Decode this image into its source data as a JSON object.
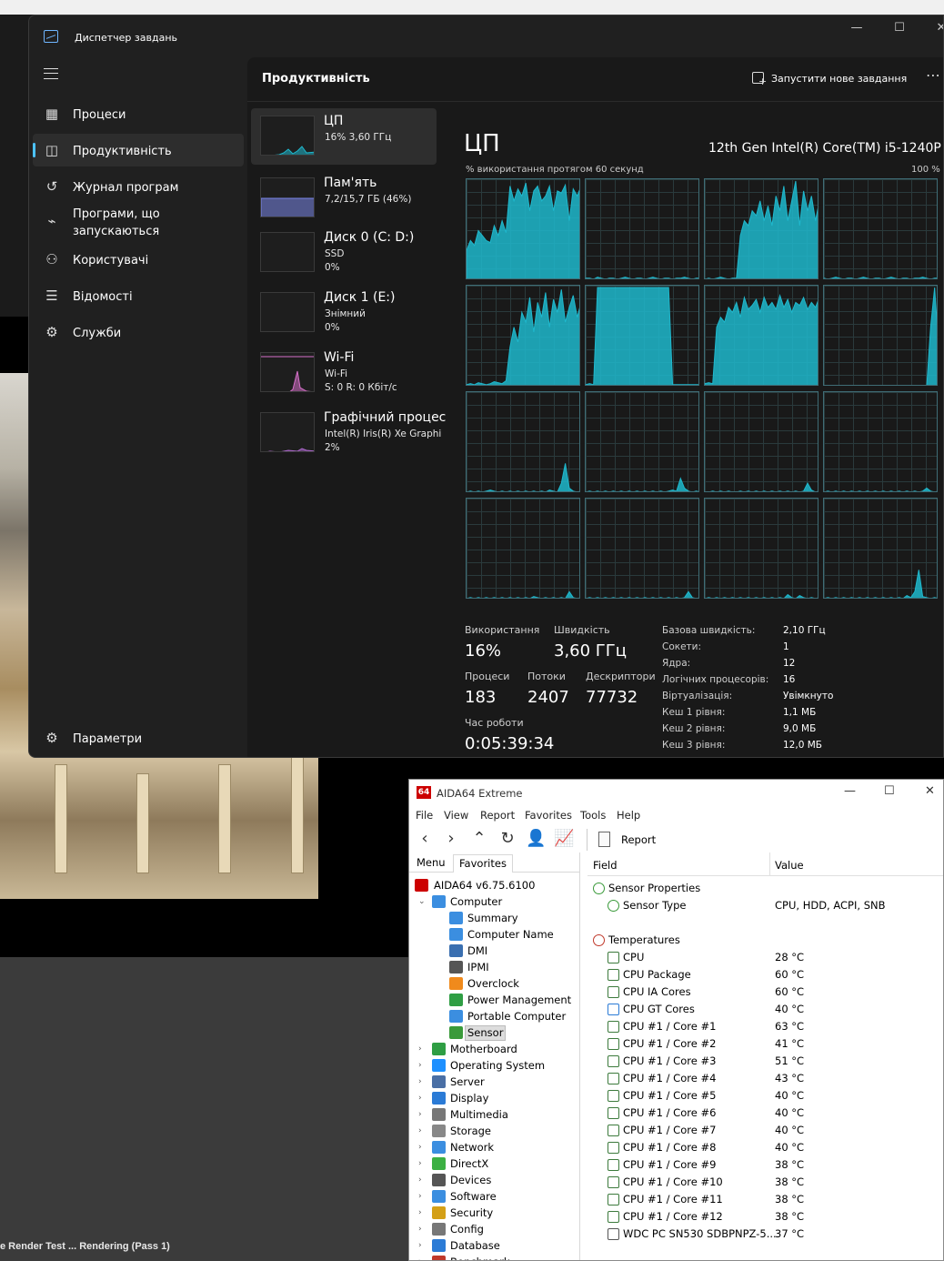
{
  "background": {
    "status_text": "e Render Test ... Rendering (Pass 1)"
  },
  "task_manager": {
    "title": "Диспетчер завдань",
    "nav": [
      {
        "label": "Процеси",
        "icon": "processes-icon",
        "glyph": "▦",
        "active": false
      },
      {
        "label": "Продуктивність",
        "icon": "performance-icon",
        "glyph": "◫",
        "active": true
      },
      {
        "label": "Журнал програм",
        "icon": "history-icon",
        "glyph": "↺",
        "active": false
      },
      {
        "label": "Програми, що\nзапускаються",
        "icon": "startup-icon",
        "glyph": "⌁",
        "active": false
      },
      {
        "label": "Користувачі",
        "icon": "users-icon",
        "glyph": "⚇",
        "active": false
      },
      {
        "label": "Відомості",
        "icon": "details-icon",
        "glyph": "☰",
        "active": false
      },
      {
        "label": "Служби",
        "icon": "services-icon",
        "glyph": "⚙",
        "active": false
      }
    ],
    "settings_label": "Параметри",
    "page_title": "Продуктивність",
    "new_task_label": "Запустити нове завдання",
    "resources": [
      {
        "name": "ЦП",
        "sub1": "16% 3,60 ГГц",
        "sub2": "",
        "color": "#1fb8cd",
        "active": true
      },
      {
        "name": "Пам'ять",
        "sub1": "7,2/15,7 ГБ (46%)",
        "sub2": "",
        "color": "#7a86e8",
        "active": false
      },
      {
        "name": "Диск 0 (C: D:)",
        "sub1": "SSD",
        "sub2": "0%",
        "color": "#4caf50",
        "active": false
      },
      {
        "name": "Диск 1 (E:)",
        "sub1": "Знімний",
        "sub2": "0%",
        "color": "#4caf50",
        "active": false
      },
      {
        "name": "Wi-Fi",
        "sub1": "Wi-Fi",
        "sub2": "S: 0 R: 0 Кбіт/с",
        "color": "#d670c9",
        "active": false
      },
      {
        "name": "Графічний процес",
        "sub1": "Intel(R) Iris(R) Xe Graphi",
        "sub2": "2%",
        "color": "#b06ad1",
        "active": false
      }
    ],
    "cpu": {
      "heading": "ЦП",
      "model": "12th Gen Intel(R) Core(TM) i5-1240P",
      "axis_left": "% використання протягом 60 секунд",
      "axis_right": "100 %",
      "graph_color": "#1fb8cd",
      "stats": {
        "usage_label": "Використання",
        "usage_value": "16%",
        "speed_label": "Швидкість",
        "speed_value": "3,60 ГГц",
        "processes_label": "Процеси",
        "processes_value": "183",
        "threads_label": "Потоки",
        "threads_value": "2407",
        "handles_label": "Дескриптори",
        "handles_value": "77732",
        "uptime_label": "Час роботи",
        "uptime_value": "0:05:39:34"
      },
      "details": [
        {
          "k": "Базова швидкість:",
          "v": "2,10 ГГц"
        },
        {
          "k": "Сокети:",
          "v": "1"
        },
        {
          "k": "Ядра:",
          "v": "12"
        },
        {
          "k": "Логічних процесорів:",
          "v": "16"
        },
        {
          "k": "Віртуалізація:",
          "v": "Увімкнуто"
        },
        {
          "k": "Кеш 1 рівня:",
          "v": "1,1 МБ"
        },
        {
          "k": "Кеш 2 рівня:",
          "v": "9,0 МБ"
        },
        {
          "k": "Кеш 3 рівня:",
          "v": "12,0 МБ"
        }
      ]
    }
  },
  "aida": {
    "title": "AIDA64 Extreme",
    "logo": "64",
    "menu": [
      "File",
      "View",
      "Report",
      "Favorites",
      "Tools",
      "Help"
    ],
    "report_label": "Report",
    "tabs": [
      "Menu",
      "Favorites"
    ],
    "tree": [
      {
        "label": "AIDA64 v6.75.6100",
        "level": 0,
        "tw": "",
        "color": "#c00",
        "icon": "aida-logo-icon"
      },
      {
        "label": "Computer",
        "level": 1,
        "tw": "⌄",
        "color": "#3b8ee0",
        "icon": "computer-icon"
      },
      {
        "label": "Summary",
        "level": 2,
        "tw": "",
        "color": "#3b8ee0",
        "icon": "summary-icon"
      },
      {
        "label": "Computer Name",
        "level": 2,
        "tw": "",
        "color": "#3b8ee0",
        "icon": "computer-name-icon"
      },
      {
        "label": "DMI",
        "level": 2,
        "tw": "",
        "color": "#3a6fb0",
        "icon": "dmi-icon"
      },
      {
        "label": "IPMI",
        "level": 2,
        "tw": "",
        "color": "#555",
        "icon": "ipmi-icon"
      },
      {
        "label": "Overclock",
        "level": 2,
        "tw": "",
        "color": "#f08a1c",
        "icon": "flame-icon"
      },
      {
        "label": "Power Management",
        "level": 2,
        "tw": "",
        "color": "#2f9e44",
        "icon": "power-icon"
      },
      {
        "label": "Portable Computer",
        "level": 2,
        "tw": "",
        "color": "#3b8ee0",
        "icon": "laptop-icon"
      },
      {
        "label": "Sensor",
        "level": 2,
        "tw": "",
        "color": "#3a9a3a",
        "icon": "sensor-icon",
        "selected": true
      },
      {
        "label": "Motherboard",
        "level": 1,
        "tw": "›",
        "color": "#2f9e44",
        "icon": "motherboard-icon"
      },
      {
        "label": "Operating System",
        "level": 1,
        "tw": "›",
        "color": "#1e90ff",
        "icon": "windows-icon"
      },
      {
        "label": "Server",
        "level": 1,
        "tw": "›",
        "color": "#4a6fa5",
        "icon": "server-icon"
      },
      {
        "label": "Display",
        "level": 1,
        "tw": "›",
        "color": "#2b7bd6",
        "icon": "display-icon"
      },
      {
        "label": "Multimedia",
        "level": 1,
        "tw": "›",
        "color": "#777",
        "icon": "multimedia-icon"
      },
      {
        "label": "Storage",
        "level": 1,
        "tw": "›",
        "color": "#888",
        "icon": "storage-icon"
      },
      {
        "label": "Network",
        "level": 1,
        "tw": "›",
        "color": "#3b8ee0",
        "icon": "network-icon"
      },
      {
        "label": "DirectX",
        "level": 1,
        "tw": "›",
        "color": "#3cb043",
        "icon": "directx-icon"
      },
      {
        "label": "Devices",
        "level": 1,
        "tw": "›",
        "color": "#555",
        "icon": "devices-icon"
      },
      {
        "label": "Software",
        "level": 1,
        "tw": "›",
        "color": "#3b8ee0",
        "icon": "software-icon"
      },
      {
        "label": "Security",
        "level": 1,
        "tw": "›",
        "color": "#d4a017",
        "icon": "shield-icon"
      },
      {
        "label": "Config",
        "level": 1,
        "tw": "›",
        "color": "#777",
        "icon": "config-icon"
      },
      {
        "label": "Database",
        "level": 1,
        "tw": "›",
        "color": "#2b7bd6",
        "icon": "database-icon"
      },
      {
        "label": "Benchmark",
        "level": 1,
        "tw": "›",
        "color": "#c0392b",
        "icon": "benchmark-icon"
      }
    ],
    "columns": {
      "field": "Field",
      "value": "Value"
    },
    "rows": [
      {
        "field": "Sensor Properties",
        "value": "",
        "indent": 0,
        "icon": "sensor-properties-icon",
        "color": "#3a9a3a"
      },
      {
        "field": "Sensor Type",
        "value": "CPU, HDD, ACPI, SNB",
        "indent": 1,
        "icon": "sensor-type-icon",
        "color": "#3a9a3a"
      },
      {
        "field": "",
        "value": "",
        "indent": 0,
        "icon": "",
        "color": ""
      },
      {
        "field": "Temperatures",
        "value": "",
        "indent": 0,
        "icon": "thermometer-icon",
        "color": "#c0392b"
      },
      {
        "field": "CPU",
        "value": "28 °C",
        "indent": 1,
        "icon": "cpu-chip-icon",
        "color": "#3c7a3c"
      },
      {
        "field": "CPU Package",
        "value": "60 °C",
        "indent": 1,
        "icon": "cpu-chip-icon",
        "color": "#3c7a3c"
      },
      {
        "field": "CPU IA Cores",
        "value": "60 °C",
        "indent": 1,
        "icon": "cpu-chip-icon",
        "color": "#3c7a3c"
      },
      {
        "field": "CPU GT Cores",
        "value": "40 °C",
        "indent": 1,
        "icon": "gpu-icon",
        "color": "#2b7bd6"
      },
      {
        "field": "CPU #1 / Core #1",
        "value": "63 °C",
        "indent": 1,
        "icon": "cpu-chip-icon",
        "color": "#3c7a3c"
      },
      {
        "field": "CPU #1 / Core #2",
        "value": "41 °C",
        "indent": 1,
        "icon": "cpu-chip-icon",
        "color": "#3c7a3c"
      },
      {
        "field": "CPU #1 / Core #3",
        "value": "51 °C",
        "indent": 1,
        "icon": "cpu-chip-icon",
        "color": "#3c7a3c"
      },
      {
        "field": "CPU #1 / Core #4",
        "value": "43 °C",
        "indent": 1,
        "icon": "cpu-chip-icon",
        "color": "#3c7a3c"
      },
      {
        "field": "CPU #1 / Core #5",
        "value": "40 °C",
        "indent": 1,
        "icon": "cpu-chip-icon",
        "color": "#3c7a3c"
      },
      {
        "field": "CPU #1 / Core #6",
        "value": "40 °C",
        "indent": 1,
        "icon": "cpu-chip-icon",
        "color": "#3c7a3c"
      },
      {
        "field": "CPU #1 / Core #7",
        "value": "40 °C",
        "indent": 1,
        "icon": "cpu-chip-icon",
        "color": "#3c7a3c"
      },
      {
        "field": "CPU #1 / Core #8",
        "value": "40 °C",
        "indent": 1,
        "icon": "cpu-chip-icon",
        "color": "#3c7a3c"
      },
      {
        "field": "CPU #1 / Core #9",
        "value": "38 °C",
        "indent": 1,
        "icon": "cpu-chip-icon",
        "color": "#3c7a3c"
      },
      {
        "field": "CPU #1 / Core #10",
        "value": "38 °C",
        "indent": 1,
        "icon": "cpu-chip-icon",
        "color": "#3c7a3c"
      },
      {
        "field": "CPU #1 / Core #11",
        "value": "38 °C",
        "indent": 1,
        "icon": "cpu-chip-icon",
        "color": "#3c7a3c"
      },
      {
        "field": "CPU #1 / Core #12",
        "value": "38 °C",
        "indent": 1,
        "icon": "cpu-chip-icon",
        "color": "#3c7a3c"
      },
      {
        "field": "WDC PC SN530 SDBPNPZ-5...",
        "value": "37 °C",
        "indent": 1,
        "icon": "drive-icon",
        "color": "#555"
      }
    ]
  }
}
